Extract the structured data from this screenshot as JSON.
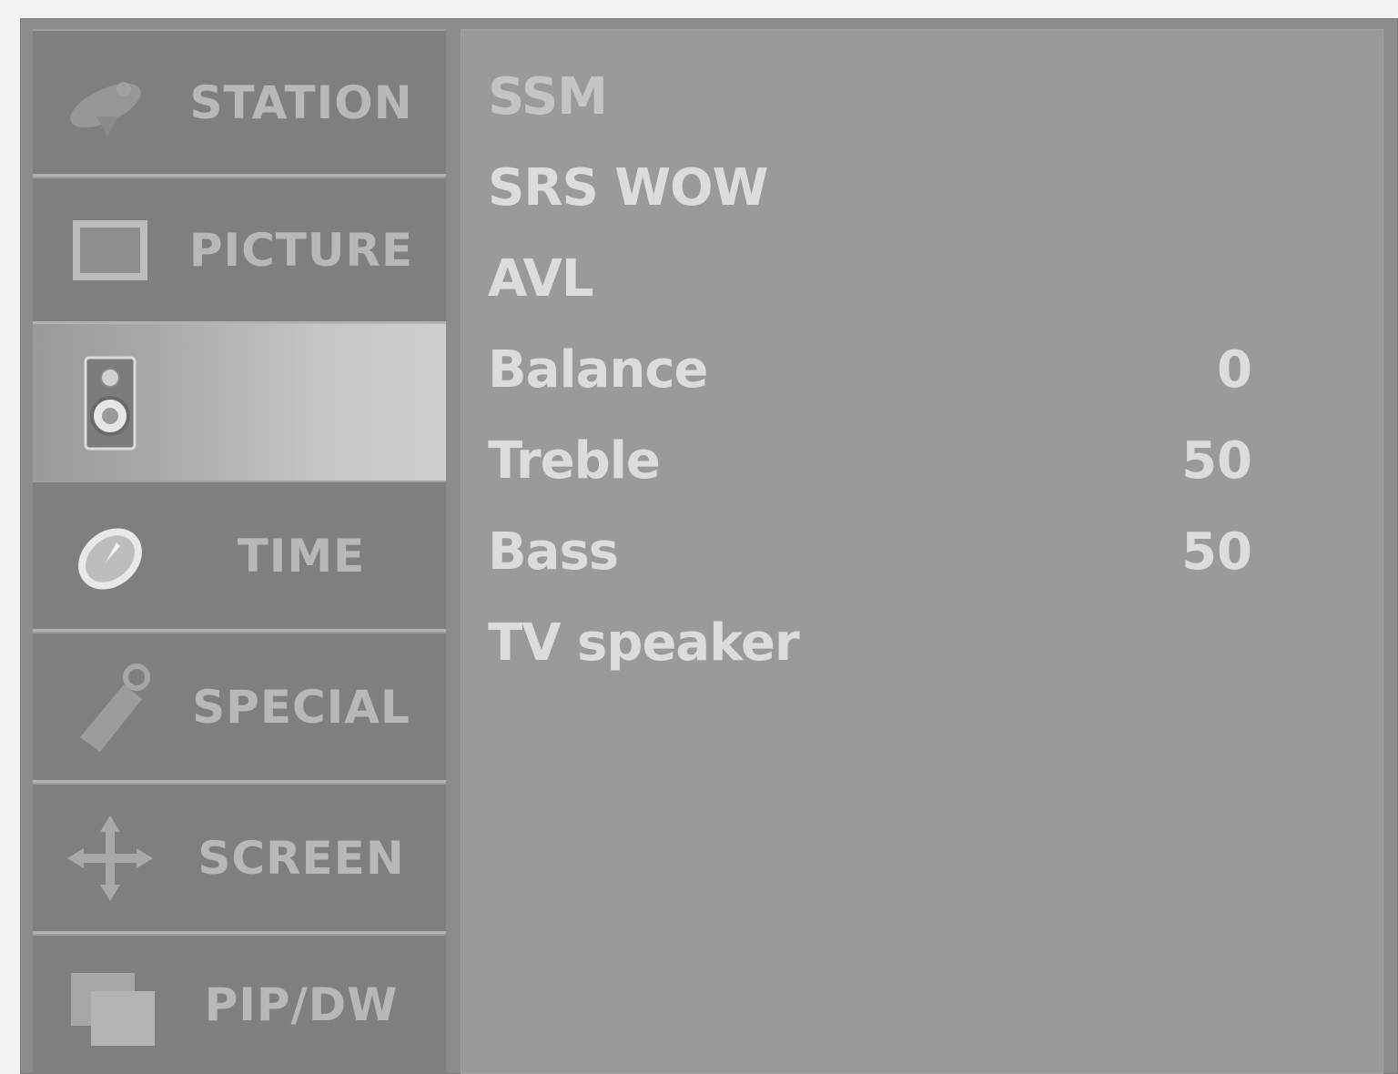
{
  "sidebar": {
    "items": [
      {
        "label": "STATION",
        "icon": "satellite-dish-icon",
        "active": false
      },
      {
        "label": "PICTURE",
        "icon": "picture-frame-icon",
        "active": false
      },
      {
        "label": "",
        "icon": "speaker-icon",
        "active": true
      },
      {
        "label": "TIME",
        "icon": "clock-icon",
        "active": false
      },
      {
        "label": "SPECIAL",
        "icon": "tag-icon",
        "active": false
      },
      {
        "label": "SCREEN",
        "icon": "move-arrows-icon",
        "active": false
      },
      {
        "label": "PIP/DW",
        "icon": "overlapping-windows-icon",
        "active": false
      }
    ]
  },
  "menu": {
    "items": [
      {
        "label": "SSM",
        "value": ""
      },
      {
        "label": "SRS WOW",
        "value": ""
      },
      {
        "label": "AVL",
        "value": ""
      },
      {
        "label": "Balance",
        "value": "0"
      },
      {
        "label": "Treble",
        "value": "50"
      },
      {
        "label": "Bass",
        "value": "50"
      },
      {
        "label": "TV speaker",
        "value": ""
      }
    ]
  }
}
